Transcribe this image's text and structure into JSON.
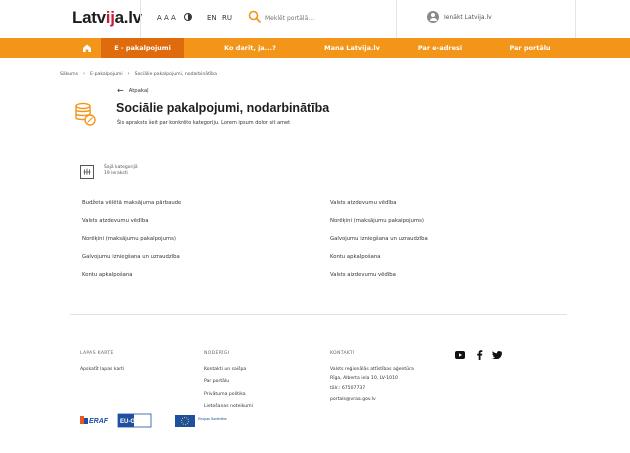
{
  "header": {
    "logo_left": "Latv",
    "logo_mid": "ij",
    "logo_right": "a.lv",
    "font_size_label": "A A A",
    "lang_en": "EN",
    "lang_ru": "RU",
    "search_placeholder": "Meklēt portālā...",
    "login_label": "Ienākt Latvija.lv"
  },
  "nav": {
    "items": [
      "E - pakalpojumi",
      "Ko darīt, ja...?",
      "Mana Latvija.lv",
      "Par e-adresi",
      "Par portālu"
    ]
  },
  "breadcrumb": [
    "Sākums",
    "E-pakalpojumi",
    "Sociālie pakalpojumi, nodarbinātība"
  ],
  "page": {
    "back_label": "Atpakaļ",
    "title": "Sociālie pakalpojumi, nodarbinātība",
    "subtitle": "Šis apraksts šeit par konkrēto kategoriju. Lorem ipsum dolor sit amet",
    "count_label": "Šajā kategorijā",
    "count_value": "19 ieraksti"
  },
  "services_left": [
    "Budžeta vēlētā maksājuma pārbaude",
    "Valsts atzdevumu vēdība",
    "Norēķini (maksājumu pakalpojums)",
    "Galvojumu izniegšana un uzraudzība",
    "Kontu apkalpošana"
  ],
  "services_right": [
    "Valsts atzdevumu vēdība",
    "Norēķini (maksājumu pakalpojums)",
    "Galvojumu izniegšana un uzraudzība",
    "Kontu apkalpošana",
    "Valsts aizdevumu vēdība"
  ],
  "footer": {
    "col1_head": "LAPAS KARTE",
    "col1_link": "Apskatīt lapas karti",
    "col2_head": "NODERĪGI",
    "col2_links": [
      "Kontakti un saišpa",
      "Par portālu",
      "Privātuma politika",
      "Lietošanas noteikumi"
    ],
    "col3_head": "KONTAKTI",
    "col3_lines": [
      "Valsts reģionālās attīstības aģentūra",
      "Rīga, Alberta iela 10, LV-1010",
      "tālr.: 67507737",
      "portals@vraa.gov.lv"
    ],
    "social": [
      "youtube-icon",
      "facebook-icon",
      "twitter-icon"
    ],
    "eu_logo_1": "ERAF",
    "eu_logo_2": "EU-G",
    "eu_logo_3": "Eiropas Savienība"
  },
  "colors": {
    "nav_bg": "#f29519",
    "nav_active": "#e06b0c",
    "accent_icon": "#f29519"
  }
}
